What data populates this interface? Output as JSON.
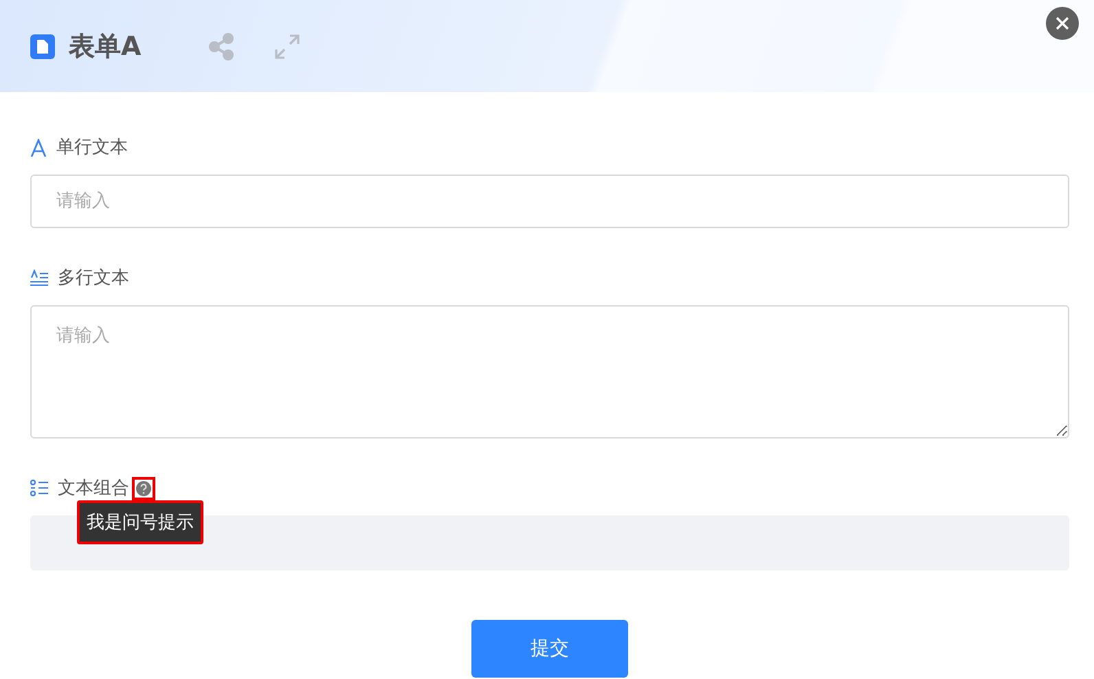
{
  "header": {
    "title": "表单A"
  },
  "fields": [
    {
      "kind": "text",
      "label": "单行文本",
      "placeholder": "请输入"
    },
    {
      "kind": "textarea",
      "label": "多行文本",
      "placeholder": "请输入"
    },
    {
      "kind": "group",
      "label": "文本组合",
      "help": {
        "tooltip": "我是问号提示",
        "highlighted": true
      }
    }
  ],
  "submit": "提交"
}
